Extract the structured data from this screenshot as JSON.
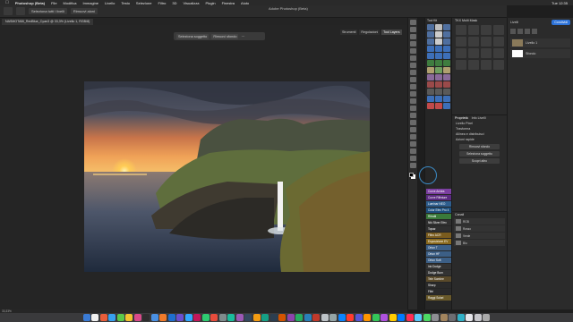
{
  "menubar": {
    "app": "Photoshop (Beta)",
    "items": [
      "File",
      "Modifica",
      "Immagine",
      "Livello",
      "Testo",
      "Selezione",
      "Filtro",
      "3D",
      "Visualizza",
      "Plugin",
      "Finestra",
      "Aiuto"
    ],
    "right": [
      "Tue 12:35"
    ]
  },
  "optbar": {
    "chip1": "Seleziona tutti i livelli",
    "chip2": "Rimuovi aloni",
    "title": "Adobe Photoshop (Beta)"
  },
  "doc_tab": "NASMOTABI_RedBlue_Cyan3 @ 33,3% (Livello 1, RGB/8)",
  "contextbar": {
    "select_subject": "Seleziona soggetto",
    "remove_bg": "Rimuovi sfondo"
  },
  "side_tabs": [
    "Strumenti",
    "Regolazioni",
    "Tool Layers"
  ],
  "statusbar": "33,33%",
  "toolkit": {
    "title": "Tool Kit",
    "list": [
      {
        "label": "Curve Anidra",
        "color": "#7b3fa0"
      },
      {
        "label": "Curve Rifinture",
        "color": "#5a2a80"
      },
      {
        "label": "Luminar NEO",
        "color": "#2e5e8e"
      },
      {
        "label": "Color Efex Pro 4",
        "color": "#1d4f7d"
      },
      {
        "label": "Ritratti",
        "color": "#3a7a3a"
      },
      {
        "label": "Nik Silver Efex",
        "color": "#303030"
      },
      {
        "label": "Topaz",
        "color": "#2f2f2f"
      },
      {
        "label": "Filtro ACR",
        "color": "#7a5c1e"
      },
      {
        "label": "Esposizione EV",
        "color": "#8a6a1e"
      },
      {
        "label": "Orton T",
        "color": "#3c5f86"
      },
      {
        "label": "Orton HF",
        "color": "#3c5f86"
      },
      {
        "label": "Orton Soft",
        "color": "#3c5f86"
      },
      {
        "label": "Ink Dodge",
        "color": "#333333"
      },
      {
        "label": "Dodge Burn",
        "color": "#333333"
      },
      {
        "label": "Tele Sombre",
        "color": "#5a4a2a"
      },
      {
        "label": "Sharp",
        "color": "#2a2a2a"
      },
      {
        "label": "Filtri",
        "color": "#2a2a2a"
      },
      {
        "label": "Raggi Solari",
        "color": "#6a5a2a"
      }
    ]
  },
  "tkx": {
    "title": "TKX Multi Mask"
  },
  "properties": {
    "tab1": "Proprietà",
    "tab2": "Info Livelli",
    "row1": "Livello Pixel",
    "row2": "Trasforma",
    "row3": "Allinea e distribuisci",
    "row4": "Azioni rapide",
    "btn1": "Rimuovi sfondo",
    "btn2": "Seleziona soggetto",
    "btn3": "Scopri altro"
  },
  "layers_mid": {
    "title": "Canali",
    "rows": [
      "RGB",
      "Rosso",
      "Verde",
      "Blu"
    ]
  },
  "layers_right": {
    "title": "Livelli",
    "share": "Condividi",
    "rows": [
      "Livello 1",
      "Sfondo"
    ]
  },
  "colors": {
    "accent": "#2e73d8",
    "highlight": "#3b8ac4"
  }
}
